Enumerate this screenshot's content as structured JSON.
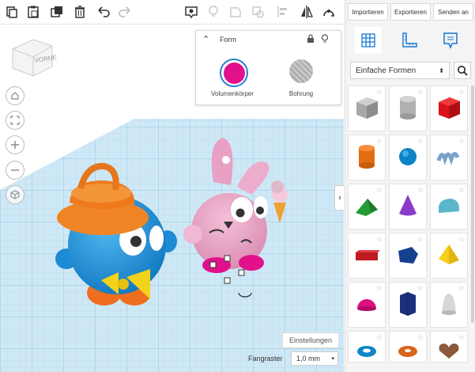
{
  "toolbar": {
    "icons": [
      "copy-icon",
      "paste-icon",
      "duplicate-icon",
      "trash-icon",
      "undo-icon",
      "redo-icon",
      "notes-icon",
      "light-icon",
      "shape-icon",
      "solid-icon",
      "align-icon",
      "mirror-icon",
      "group-icon"
    ]
  },
  "viewcube": {
    "label": "VORNE"
  },
  "shape_panel": {
    "title": "Form",
    "solid_label": "Volumenkörper",
    "hole_label": "Bohrung",
    "solid_color": "#e0118b",
    "hole_color": "#bdbdbd"
  },
  "sidebar": {
    "buttons": {
      "import": "Importieren",
      "export": "Exportieren",
      "send": "Senden an"
    },
    "category": "Einfache Formen",
    "shapes": [
      "box-gray-icon",
      "cylinder-gray-icon",
      "box-red-icon",
      "cylinder-orange-icon",
      "sphere-blue-icon",
      "scribble-icon",
      "roof-green-icon",
      "cone-purple-icon",
      "round-roof-teal-icon",
      "text-red-icon",
      "polygon-blue-icon",
      "pyramid-yellow-icon",
      "half-sphere-pink-icon",
      "polygon-navy-icon",
      "paraboloid-gray-icon",
      "torus-blue-icon",
      "tube-orange-icon",
      "heart-brown-icon"
    ]
  },
  "bottom": {
    "settings_label": "Einstellungen",
    "grid_label": "Fangraster",
    "grid_value": "1,0 mm"
  },
  "colors": {
    "accent": "#1477d4",
    "grid_bg": "#c8e6f5"
  }
}
